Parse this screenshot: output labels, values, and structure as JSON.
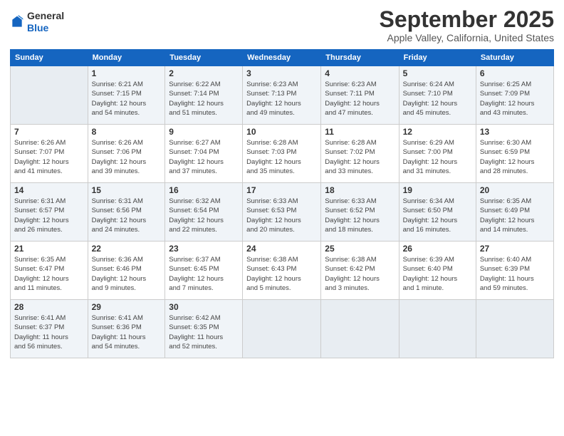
{
  "header": {
    "logo_line1": "General",
    "logo_line2": "Blue",
    "month_title": "September 2025",
    "location": "Apple Valley, California, United States"
  },
  "weekdays": [
    "Sunday",
    "Monday",
    "Tuesday",
    "Wednesday",
    "Thursday",
    "Friday",
    "Saturday"
  ],
  "weeks": [
    [
      {
        "day": "",
        "info": ""
      },
      {
        "day": "1",
        "info": "Sunrise: 6:21 AM\nSunset: 7:15 PM\nDaylight: 12 hours\nand 54 minutes."
      },
      {
        "day": "2",
        "info": "Sunrise: 6:22 AM\nSunset: 7:14 PM\nDaylight: 12 hours\nand 51 minutes."
      },
      {
        "day": "3",
        "info": "Sunrise: 6:23 AM\nSunset: 7:13 PM\nDaylight: 12 hours\nand 49 minutes."
      },
      {
        "day": "4",
        "info": "Sunrise: 6:23 AM\nSunset: 7:11 PM\nDaylight: 12 hours\nand 47 minutes."
      },
      {
        "day": "5",
        "info": "Sunrise: 6:24 AM\nSunset: 7:10 PM\nDaylight: 12 hours\nand 45 minutes."
      },
      {
        "day": "6",
        "info": "Sunrise: 6:25 AM\nSunset: 7:09 PM\nDaylight: 12 hours\nand 43 minutes."
      }
    ],
    [
      {
        "day": "7",
        "info": "Sunrise: 6:26 AM\nSunset: 7:07 PM\nDaylight: 12 hours\nand 41 minutes."
      },
      {
        "day": "8",
        "info": "Sunrise: 6:26 AM\nSunset: 7:06 PM\nDaylight: 12 hours\nand 39 minutes."
      },
      {
        "day": "9",
        "info": "Sunrise: 6:27 AM\nSunset: 7:04 PM\nDaylight: 12 hours\nand 37 minutes."
      },
      {
        "day": "10",
        "info": "Sunrise: 6:28 AM\nSunset: 7:03 PM\nDaylight: 12 hours\nand 35 minutes."
      },
      {
        "day": "11",
        "info": "Sunrise: 6:28 AM\nSunset: 7:02 PM\nDaylight: 12 hours\nand 33 minutes."
      },
      {
        "day": "12",
        "info": "Sunrise: 6:29 AM\nSunset: 7:00 PM\nDaylight: 12 hours\nand 31 minutes."
      },
      {
        "day": "13",
        "info": "Sunrise: 6:30 AM\nSunset: 6:59 PM\nDaylight: 12 hours\nand 28 minutes."
      }
    ],
    [
      {
        "day": "14",
        "info": "Sunrise: 6:31 AM\nSunset: 6:57 PM\nDaylight: 12 hours\nand 26 minutes."
      },
      {
        "day": "15",
        "info": "Sunrise: 6:31 AM\nSunset: 6:56 PM\nDaylight: 12 hours\nand 24 minutes."
      },
      {
        "day": "16",
        "info": "Sunrise: 6:32 AM\nSunset: 6:54 PM\nDaylight: 12 hours\nand 22 minutes."
      },
      {
        "day": "17",
        "info": "Sunrise: 6:33 AM\nSunset: 6:53 PM\nDaylight: 12 hours\nand 20 minutes."
      },
      {
        "day": "18",
        "info": "Sunrise: 6:33 AM\nSunset: 6:52 PM\nDaylight: 12 hours\nand 18 minutes."
      },
      {
        "day": "19",
        "info": "Sunrise: 6:34 AM\nSunset: 6:50 PM\nDaylight: 12 hours\nand 16 minutes."
      },
      {
        "day": "20",
        "info": "Sunrise: 6:35 AM\nSunset: 6:49 PM\nDaylight: 12 hours\nand 14 minutes."
      }
    ],
    [
      {
        "day": "21",
        "info": "Sunrise: 6:35 AM\nSunset: 6:47 PM\nDaylight: 12 hours\nand 11 minutes."
      },
      {
        "day": "22",
        "info": "Sunrise: 6:36 AM\nSunset: 6:46 PM\nDaylight: 12 hours\nand 9 minutes."
      },
      {
        "day": "23",
        "info": "Sunrise: 6:37 AM\nSunset: 6:45 PM\nDaylight: 12 hours\nand 7 minutes."
      },
      {
        "day": "24",
        "info": "Sunrise: 6:38 AM\nSunset: 6:43 PM\nDaylight: 12 hours\nand 5 minutes."
      },
      {
        "day": "25",
        "info": "Sunrise: 6:38 AM\nSunset: 6:42 PM\nDaylight: 12 hours\nand 3 minutes."
      },
      {
        "day": "26",
        "info": "Sunrise: 6:39 AM\nSunset: 6:40 PM\nDaylight: 12 hours\nand 1 minute."
      },
      {
        "day": "27",
        "info": "Sunrise: 6:40 AM\nSunset: 6:39 PM\nDaylight: 11 hours\nand 59 minutes."
      }
    ],
    [
      {
        "day": "28",
        "info": "Sunrise: 6:41 AM\nSunset: 6:37 PM\nDaylight: 11 hours\nand 56 minutes."
      },
      {
        "day": "29",
        "info": "Sunrise: 6:41 AM\nSunset: 6:36 PM\nDaylight: 11 hours\nand 54 minutes."
      },
      {
        "day": "30",
        "info": "Sunrise: 6:42 AM\nSunset: 6:35 PM\nDaylight: 11 hours\nand 52 minutes."
      },
      {
        "day": "",
        "info": ""
      },
      {
        "day": "",
        "info": ""
      },
      {
        "day": "",
        "info": ""
      },
      {
        "day": "",
        "info": ""
      }
    ]
  ]
}
